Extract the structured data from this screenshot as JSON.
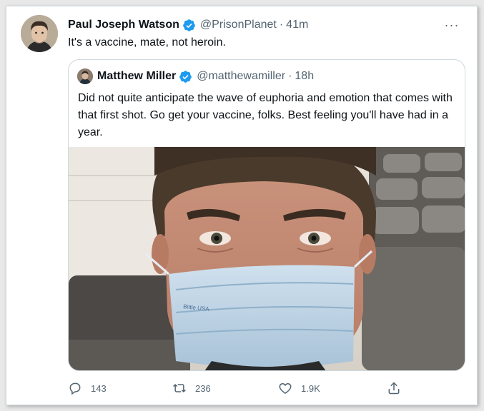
{
  "tweet": {
    "author_name": "Paul Joseph Watson",
    "handle": "@PrisonPlanet",
    "separator": "·",
    "time": "41m",
    "more_label": "···",
    "text": "It's a vaccine, mate, not heroin."
  },
  "quoted_tweet": {
    "author_name": "Matthew Miller",
    "handle": "@matthewamiller",
    "separator": "·",
    "time": "18h",
    "text": "Did not quite anticipate the wave of euphoria and emotion that comes with that first shot. Go get your vaccine, folks. Best feeling you'll have had in a year.",
    "mask_print": "Bittle USA"
  },
  "actions": {
    "reply_count": "143",
    "retweet_count": "236",
    "like_count": "1.9K"
  },
  "colors": {
    "verified": "#1d9bf0",
    "secondary_text": "#536471",
    "border": "#cfd9de"
  }
}
